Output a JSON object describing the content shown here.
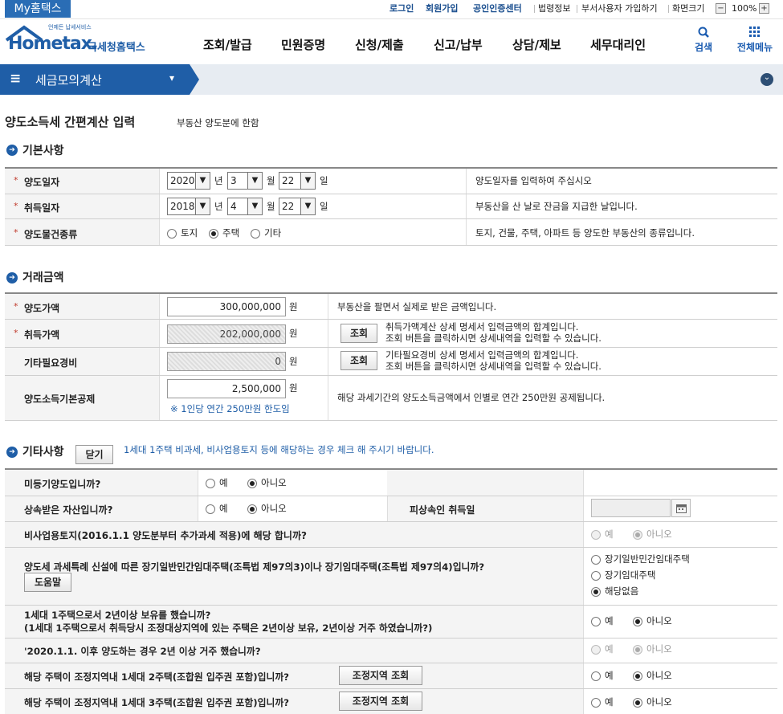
{
  "topbar": {
    "mytab": "My홈택스",
    "links_bold": [
      "로그인",
      "회원가입",
      "공인인증센터"
    ],
    "links": [
      "법령정보",
      "부서사용자 가입하기",
      "화면크기"
    ],
    "zoom_minus": "−",
    "zoom_value": "100%",
    "zoom_plus": "+"
  },
  "header": {
    "logo_small": "언제든 납세서비스",
    "logo_main": "Hometax.",
    "logo_sub": "국세청홈택스",
    "menu": [
      "조회/발급",
      "민원증명",
      "신청/제출",
      "신고/납부",
      "상담/제보",
      "세무대리인"
    ],
    "search_label": "검색",
    "allmenu_label": "전체메뉴"
  },
  "breadcrumb": {
    "menu_icon": "≡",
    "title": "세금모의계산",
    "chevron": "▾",
    "circle": "⌄"
  },
  "page": {
    "title": "양도소득세 간편계산 입력",
    "subtitle": "부동산 양도분에 한함"
  },
  "basic": {
    "title": "기본사항",
    "sale_date": {
      "label": "양도일자",
      "year": "2020",
      "month": "3",
      "day": "22",
      "year_unit": "년",
      "month_unit": "월",
      "day_unit": "일",
      "help": "양도일자를 입력하여 주십시오"
    },
    "acq_date": {
      "label": "취득일자",
      "year": "2018",
      "month": "4",
      "day": "22",
      "year_unit": "년",
      "month_unit": "월",
      "day_unit": "일",
      "help": "부동산을 산 날로 잔금을 지급한 날입니다."
    },
    "type": {
      "label": "양도물건종류",
      "options": [
        "토지",
        "주택",
        "기타"
      ],
      "selected": "주택",
      "help": "토지, 건물, 주택, 아파트 등 양도한 부동산의 종류입니다."
    }
  },
  "amount": {
    "title": "거래금액",
    "unit": "원",
    "sale_price": {
      "label": "양도가액",
      "value": "300,000,000",
      "help": "부동산을 팔면서 실제로 받은 금액입니다."
    },
    "acq_price": {
      "label": "취득가액",
      "value": "202,000,000",
      "btn": "조회",
      "help1": "취득가액계산 상세 명세서 입력금액의 합계입니다.",
      "help2": "조회 버튼을 클릭하시면 상세내역을 입력할 수 있습니다."
    },
    "other_cost": {
      "label": "기타필요경비",
      "value": "0",
      "btn": "조회",
      "help1": "기타필요경비 상세 명세서 입력금액의 합계입니다.",
      "help2": "조회 버튼을 클릭하시면 상세내역을 입력할 수 있습니다."
    },
    "basic_deduct": {
      "label": "양도소득기본공제",
      "value": "2,500,000",
      "note": "※ 1인당 연간 250만원 한도임",
      "help": "해당 과세기간의 양도소득금액에서 인별로 연간 250만원 공제됩니다."
    }
  },
  "other": {
    "title": "기타사항",
    "close_btn": "닫기",
    "hint": "1세대 1주택 비과세, 비사업용토지 등에 해당하는 경우 체크 해 주시기 바랍니다.",
    "yes": "예",
    "no": "아니오",
    "q1": "미등기양도입니까?",
    "q2": "상속받은 자산입니까?",
    "q2_extra": "피상속인 취득일",
    "q3": "비사업용토지(2016.1.1 양도분부터 추가과세 적용)에 해당 합니까?",
    "q4": "양도세 과세특례 신설에 따른 장기일반민간임대주택(조특법 제97의3)이나 장기임대주택(조특법 제97의4)입니까?",
    "q4_help_btn": "도움말",
    "q4_options": [
      "장기일반민간임대주택",
      "장기임대주택",
      "해당없음"
    ],
    "q4_selected": "해당없음",
    "q5_line1": "1세대 1주택으로서 2년이상 보유를 했습니까?",
    "q5_line2": "(1세대 1주택으로서 취득당시 조정대상지역에 있는 주택은 2년이상 보유, 2년이상 거주 하였습니까?)",
    "q6": "'2020.1.1. 이후 양도하는 경우 2년 이상 거주 했습니까?",
    "q7": "해당 주택이 조정지역내 1세대 2주택(조합원 입주권 포함)입니까?",
    "q8": "해당 주택이 조정지역내 1세대 3주택(조합원 입주권 포함)입니까?",
    "region_btn": "조정지역 조회"
  },
  "colors": {
    "brand_blue": "#1f5ea7",
    "required_red": "#c0392b"
  }
}
